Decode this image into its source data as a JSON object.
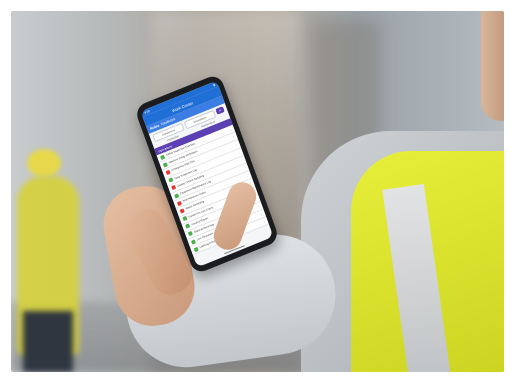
{
  "app": {
    "title": "Work Center",
    "brand": "Nokia",
    "subtitle": "TotalWork",
    "status_time": "9:30",
    "filters": [
      "Department",
      "Workstation"
    ],
    "filter_button": "≡",
    "tabs": [
      "Production",
      "Maintenance"
    ],
    "section_title": "Operations",
    "rows": [
      {
        "label": "Safety Inspection Checklist",
        "icon_color": "#4caf50"
      },
      {
        "label": "Machine Setup Verification",
        "icon_color": "#4caf50"
      },
      {
        "label": "Emergency Stop Test",
        "icon_color": "#e53935"
      },
      {
        "label": "Daily Production Log",
        "icon_color": "#4caf50"
      },
      {
        "label": "Quality Control Sampling",
        "icon_color": "#e53935"
      },
      {
        "label": "Equipment Maintenance Log",
        "icon_color": "#4caf50"
      },
      {
        "label": "Shift Handover Notes",
        "icon_color": "#e53935"
      },
      {
        "label": "Waste Recording",
        "icon_color": "#e53935"
      },
      {
        "label": "Forklift Pre-Use Check",
        "icon_color": "#4caf50"
      },
      {
        "label": "Incident Report",
        "icon_color": "#4caf50"
      },
      {
        "label": "Material Receiving",
        "icon_color": "#4caf50"
      },
      {
        "label": "Line Clearance",
        "icon_color": "#4caf50"
      },
      {
        "label": "Labeling Check",
        "icon_color": "#4caf50"
      }
    ]
  },
  "colors": {
    "primary": "#1f6fd6",
    "accent": "#5b3fb3",
    "vest": "#e2ea34"
  }
}
